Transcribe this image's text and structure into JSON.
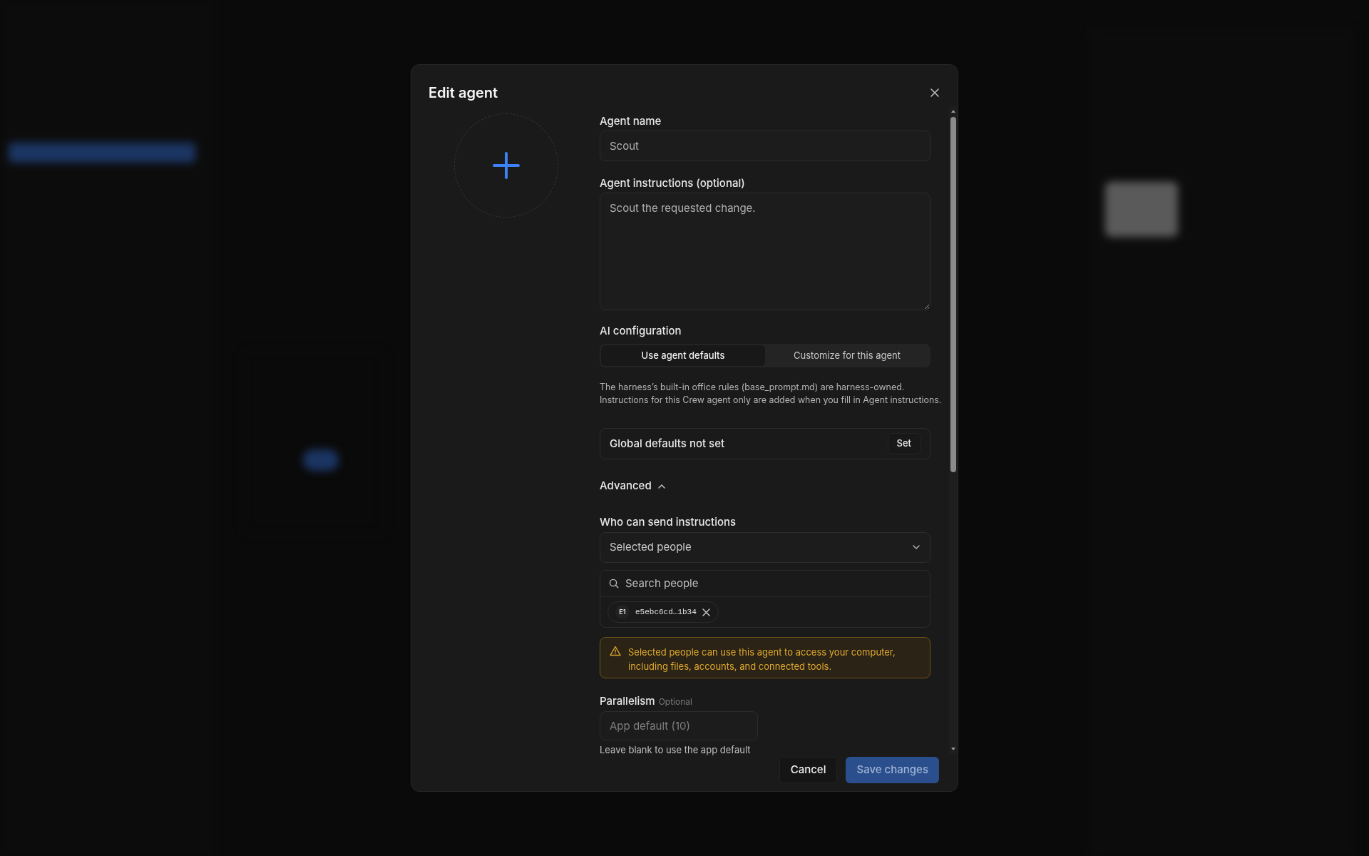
{
  "dialog": {
    "title": "Edit agent"
  },
  "fields": {
    "name": {
      "label": "Agent name",
      "value": "Scout"
    },
    "instructions": {
      "label": "Agent instructions (optional)",
      "value": "Scout the requested change."
    }
  },
  "ai_configuration": {
    "label": "AI configuration",
    "options": [
      {
        "label": "Use agent defaults",
        "selected": true
      },
      {
        "label": "Customize for this agent",
        "selected": false
      }
    ],
    "description_lines": [
      "The harness’s built-in office rules (base_prompt.md) are harness-owned.",
      "Instructions for this Crew agent only are added when you fill in Agent instructions."
    ],
    "defaults_card": {
      "text": "Global defaults not set",
      "button": "Set"
    }
  },
  "advanced": {
    "label": "Advanced",
    "expanded": true,
    "who_can_send": {
      "label": "Who can send instructions",
      "value": "Selected people",
      "search_placeholder": "Search people",
      "chips": [
        {
          "badge": "E1",
          "label": "e5ebc6cd…1b34"
        }
      ]
    },
    "warning": "Selected people can use this agent to access your computer, including files, accounts, and connected tools.",
    "parallelism": {
      "label": "Parallelism",
      "tag": "Optional",
      "placeholder": "App default (10)",
      "hint": "Leave blank to use the app default"
    }
  },
  "buttons": [
    {
      "label": "Cancel",
      "kind": "secondary"
    },
    {
      "label": "Save changes",
      "kind": "primary"
    }
  ]
}
